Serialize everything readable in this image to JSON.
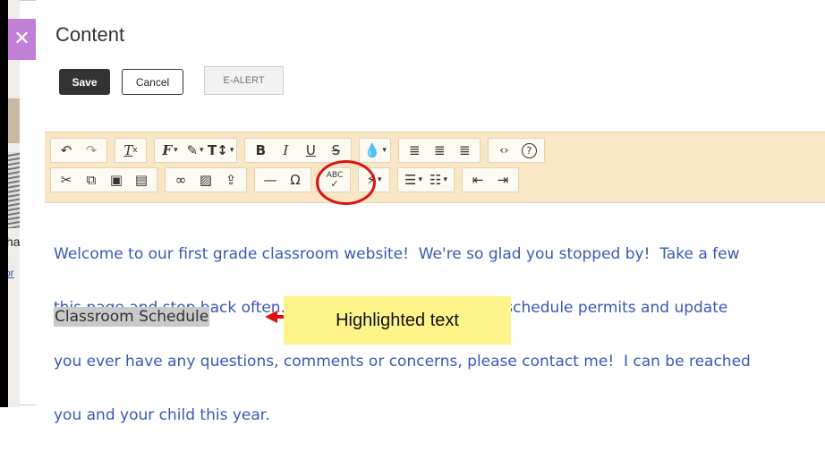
{
  "background": {
    "line1": "ha",
    "line2": "t",
    "line3": "or"
  },
  "panel": {
    "title": "Content"
  },
  "actions": {
    "save": "Save",
    "cancel": "Cancel",
    "ealert": "E-ALERT"
  },
  "toolbar": {
    "row1": [
      {
        "name": "undo-icon",
        "glyph": "↶"
      },
      {
        "name": "redo-icon",
        "glyph": "↷",
        "dim": true
      },
      {
        "name": "clear-format-icon",
        "glyph": "Ix"
      },
      {
        "name": "font-family-icon",
        "glyph": "𝓕"
      },
      {
        "name": "font-color-pen-icon",
        "glyph": "✎"
      },
      {
        "name": "font-size-icon",
        "glyph": "T↕"
      },
      {
        "name": "bold-icon",
        "glyph": "B"
      },
      {
        "name": "italic-icon",
        "glyph": "I"
      },
      {
        "name": "underline-icon",
        "glyph": "U"
      },
      {
        "name": "strikethrough-icon",
        "glyph": "S"
      },
      {
        "name": "paragraph-format-icon",
        "glyph": "●"
      },
      {
        "name": "align-left-icon",
        "glyph": "≡"
      },
      {
        "name": "align-center-icon",
        "glyph": "≡"
      },
      {
        "name": "align-right-icon",
        "glyph": "≡"
      },
      {
        "name": "code-view-icon",
        "glyph": "‹›"
      },
      {
        "name": "help-icon",
        "glyph": "?"
      }
    ],
    "row2": [
      {
        "name": "cut-icon",
        "glyph": "✂"
      },
      {
        "name": "copy-icon",
        "glyph": "⎘"
      },
      {
        "name": "paste-icon",
        "glyph": "📋"
      },
      {
        "name": "paste-text-icon",
        "glyph": "🗒"
      },
      {
        "name": "link-icon",
        "glyph": "🔗"
      },
      {
        "name": "image-icon",
        "glyph": "🖼"
      },
      {
        "name": "upload-icon",
        "glyph": "⇧"
      },
      {
        "name": "horizontal-line-icon",
        "glyph": "—"
      },
      {
        "name": "special-char-icon",
        "glyph": "Ω"
      },
      {
        "name": "spellcheck-icon",
        "glyph": "ABC✓"
      },
      {
        "name": "quick-insert-icon",
        "glyph": "⚡"
      },
      {
        "name": "bullet-list-icon",
        "glyph": "☰"
      },
      {
        "name": "numbered-list-icon",
        "glyph": "☰"
      },
      {
        "name": "outdent-icon",
        "glyph": "⇤"
      },
      {
        "name": "indent-icon",
        "glyph": "⇥"
      }
    ]
  },
  "editor": {
    "line1": "Welcome to our first grade classroom website!  We're so glad you stopped by!  Take a few",
    "line2": "this page and stop back often.  We'll add blog posts as our schedule permits and update",
    "line3": "you ever have any questions, comments or concerns, please contact me!  I can be reached",
    "line4": "you and your child this year.",
    "highlighted": "Classroom Schedule"
  },
  "annotation": {
    "callout": "Highlighted text"
  },
  "colors": {
    "close_tab": "#c27fd6",
    "toolbar_bg": "#f8e6c5",
    "callout_bg": "#fff48a",
    "circle": "#dd1111",
    "arrow": "#dd1111"
  }
}
